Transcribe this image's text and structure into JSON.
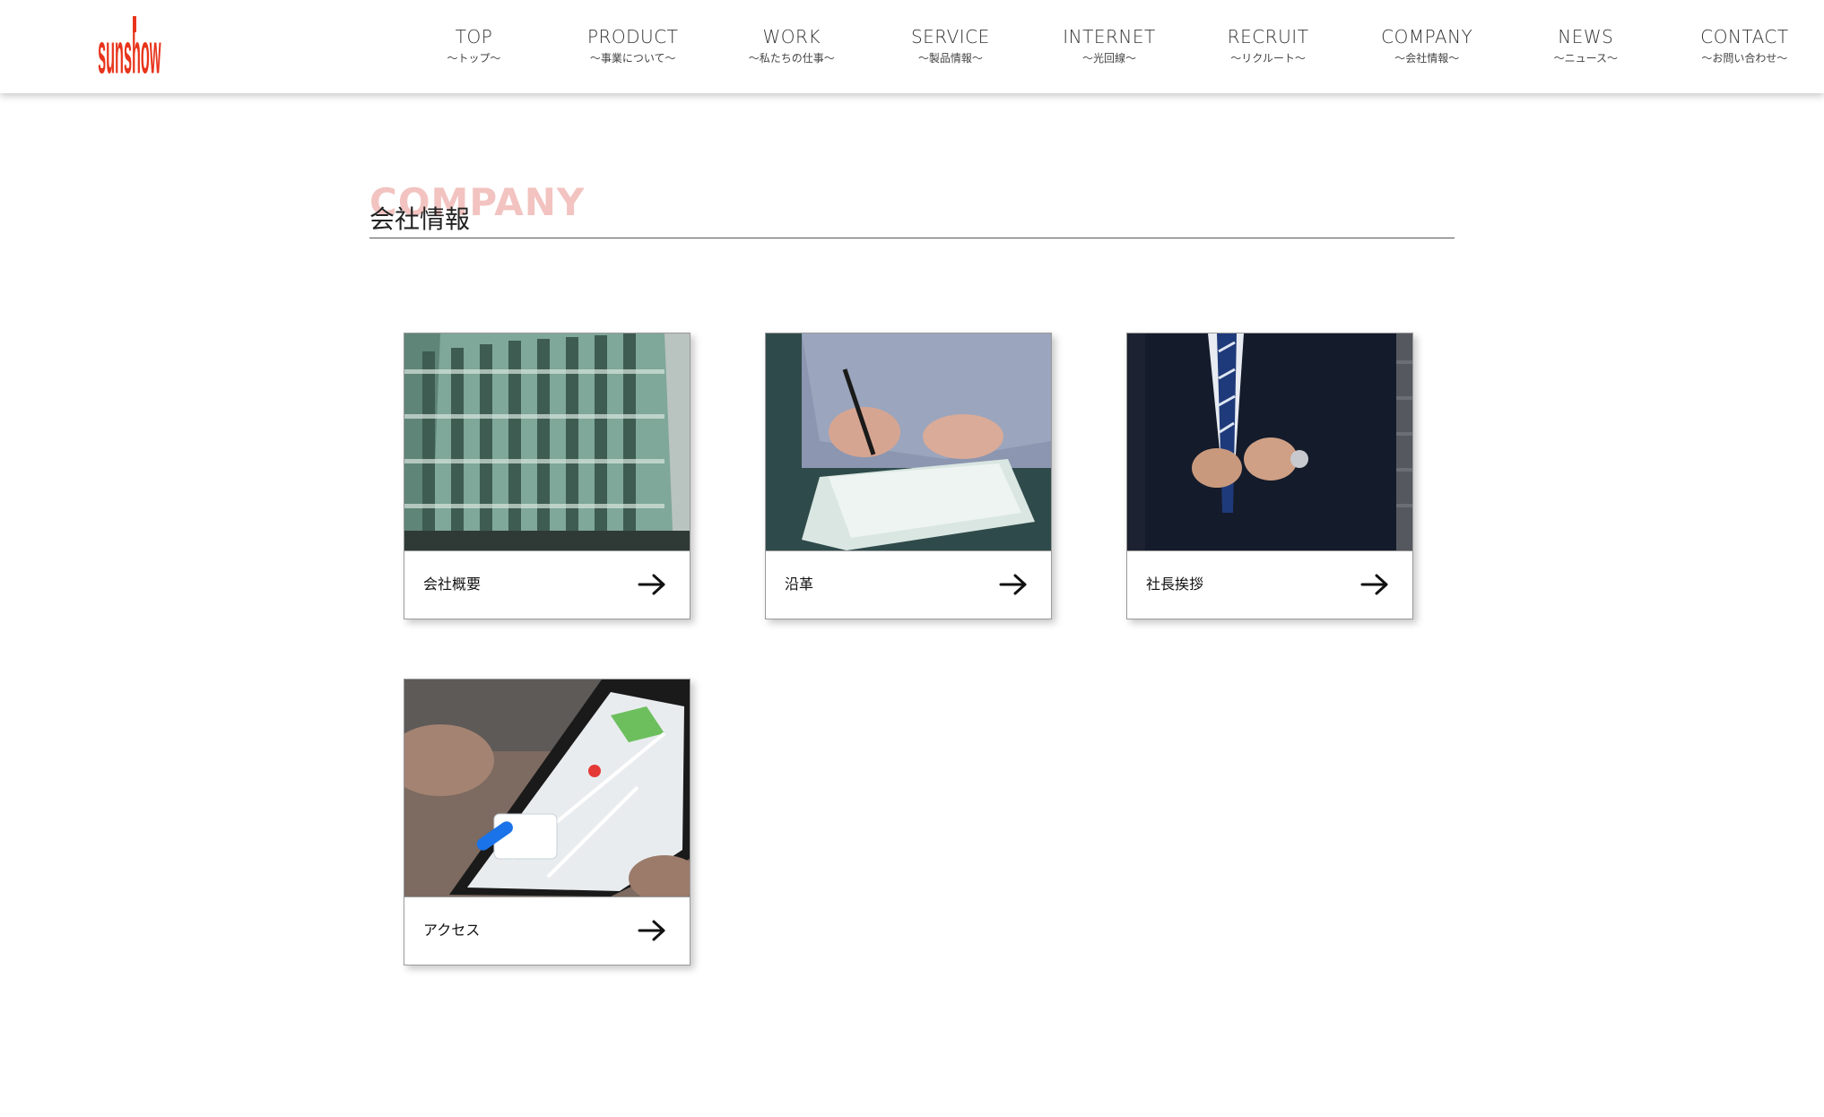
{
  "brand": {
    "logo_text": "sunshow",
    "logo_color": "#e8341c"
  },
  "nav": [
    {
      "label": "TOP",
      "sub": "〜トップ〜"
    },
    {
      "label": "PRODUCT",
      "sub": "〜事業について〜"
    },
    {
      "label": "WORK",
      "sub": "〜私たちの仕事〜"
    },
    {
      "label": "SERVICE",
      "sub": "〜製品情報〜"
    },
    {
      "label": "INTERNET",
      "sub": "〜光回線〜"
    },
    {
      "label": "RECRUIT",
      "sub": "〜リクルート〜"
    },
    {
      "label": "COMPANY",
      "sub": "〜会社情報〜"
    },
    {
      "label": "NEWS",
      "sub": "〜ニュース〜"
    },
    {
      "label": "CONTACT",
      "sub": "〜お問い合わせ〜"
    }
  ],
  "section": {
    "title_en": "COMPANY",
    "title_ja": "会社情報",
    "accent": "#f2c3c0"
  },
  "cards": [
    {
      "label": "会社概要",
      "icon": "arrow-right-icon",
      "image": "office-building-photo"
    },
    {
      "label": "沿革",
      "icon": "arrow-right-icon",
      "image": "signing-document-photo"
    },
    {
      "label": "社長挨拶",
      "icon": "arrow-right-icon",
      "image": "businessman-suit-photo"
    },
    {
      "label": "アクセス",
      "icon": "arrow-right-icon",
      "image": "smartphone-map-photo"
    }
  ]
}
